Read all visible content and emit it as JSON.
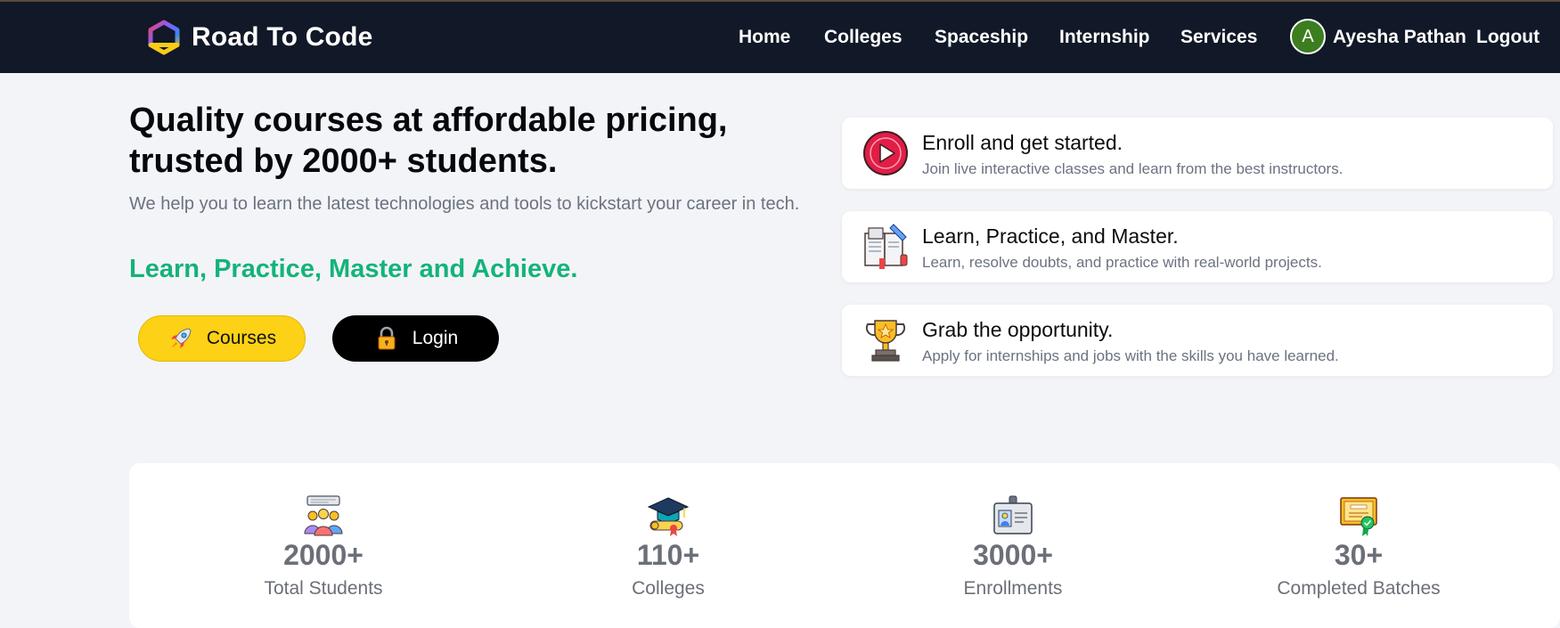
{
  "navbar": {
    "brand": "Road To Code",
    "links": [
      "Home",
      "Colleges",
      "Spaceship",
      "Internship",
      "Services"
    ],
    "user": {
      "initial": "A",
      "name": "Ayesha Pathan"
    },
    "logout": "Logout",
    "colors": {
      "background": "#111827",
      "avatar": "#3b7d1f"
    }
  },
  "hero": {
    "title": "Quality courses at affordable pricing, trusted by 2000+ students.",
    "subtitle": "We help you to learn the latest technologies and tools to kickstart your career in tech.",
    "tagline": "Learn, Practice, Master and Achieve.",
    "tagline_color": "#13b37a",
    "buttons": {
      "courses": {
        "label": "Courses",
        "icon": "rocket-icon",
        "color": "#fcd116"
      },
      "login": {
        "label": "Login",
        "icon": "lock-icon",
        "color": "#000000"
      }
    }
  },
  "features": [
    {
      "icon": "play-icon",
      "title": "Enroll and get started.",
      "description": "Join live interactive classes and learn from the best instructors."
    },
    {
      "icon": "book-icon",
      "title": "Learn, Practice, and Master.",
      "description": "Learn, resolve doubts, and practice with real-world projects."
    },
    {
      "icon": "trophy-icon",
      "title": "Grab the opportunity.",
      "description": "Apply for internships and jobs with the skills you have learned."
    }
  ],
  "stats": [
    {
      "icon": "students-icon",
      "value": "2000+",
      "label": "Total Students"
    },
    {
      "icon": "graduation-cap-icon",
      "value": "110+",
      "label": "Colleges"
    },
    {
      "icon": "id-card-icon",
      "value": "3000+",
      "label": "Enrollments"
    },
    {
      "icon": "certificate-icon",
      "value": "30+",
      "label": "Completed Batches"
    }
  ]
}
